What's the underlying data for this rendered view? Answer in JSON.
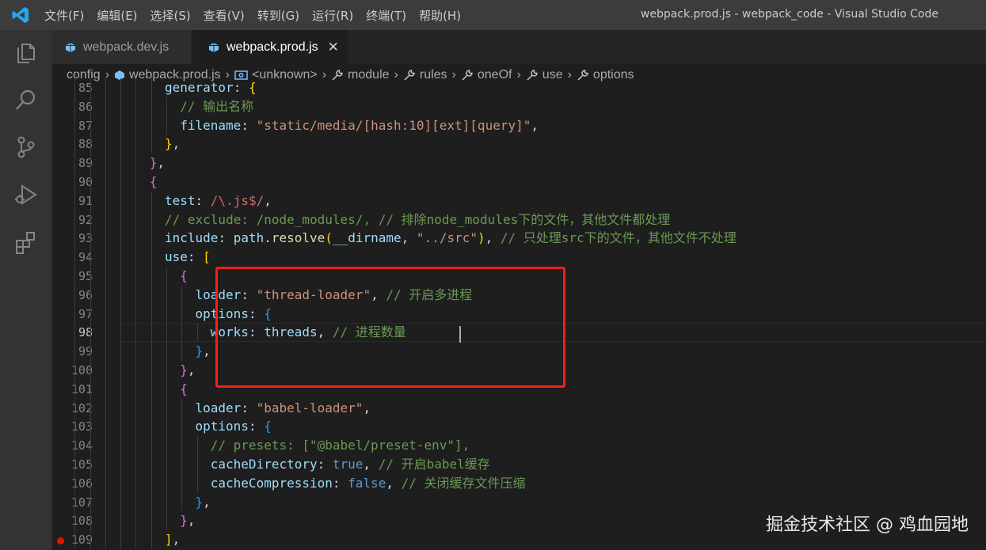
{
  "window": {
    "title": "webpack.prod.js - webpack_code - Visual Studio Code"
  },
  "menu": [
    {
      "label": "文件(F)",
      "name": "menu-file"
    },
    {
      "label": "编辑(E)",
      "name": "menu-edit"
    },
    {
      "label": "选择(S)",
      "name": "menu-selection"
    },
    {
      "label": "查看(V)",
      "name": "menu-view"
    },
    {
      "label": "转到(G)",
      "name": "menu-go"
    },
    {
      "label": "运行(R)",
      "name": "menu-run"
    },
    {
      "label": "终端(T)",
      "name": "menu-terminal"
    },
    {
      "label": "帮助(H)",
      "name": "menu-help"
    }
  ],
  "activity_bar": [
    "explorer-icon",
    "search-icon",
    "source-control-icon",
    "run-debug-icon",
    "extensions-icon"
  ],
  "tabs": [
    {
      "label": "webpack.dev.js",
      "active": false
    },
    {
      "label": "webpack.prod.js",
      "active": true,
      "close": "✕"
    }
  ],
  "breadcrumb": [
    {
      "label": "config"
    },
    {
      "label": "webpack.prod.js"
    },
    {
      "label": "<unknown>"
    },
    {
      "label": "module"
    },
    {
      "label": "rules"
    },
    {
      "label": "oneOf"
    },
    {
      "label": "use"
    },
    {
      "label": "options"
    }
  ],
  "editor": {
    "active_line": 98,
    "lines": [
      {
        "n": 85,
        "indent": 6,
        "tokens": [
          [
            "k",
            "generator"
          ],
          [
            "p",
            ": "
          ],
          [
            "y",
            "{"
          ]
        ]
      },
      {
        "n": 86,
        "indent": 7,
        "tokens": [
          [
            "c",
            "// 输出名称"
          ]
        ]
      },
      {
        "n": 87,
        "indent": 7,
        "tokens": [
          [
            "k",
            "filename"
          ],
          [
            "p",
            ": "
          ],
          [
            "s",
            "\"static/media/[hash:10][ext][query]\""
          ],
          [
            "p",
            ","
          ]
        ]
      },
      {
        "n": 88,
        "indent": 6,
        "tokens": [
          [
            "y",
            "}"
          ],
          [
            "p",
            ","
          ]
        ]
      },
      {
        "n": 89,
        "indent": 5,
        "tokens": [
          [
            "m",
            "}"
          ],
          [
            "p",
            ","
          ]
        ]
      },
      {
        "n": 90,
        "indent": 5,
        "tokens": [
          [
            "m",
            "{"
          ]
        ]
      },
      {
        "n": 91,
        "indent": 6,
        "tokens": [
          [
            "k",
            "test"
          ],
          [
            "p",
            ": "
          ],
          [
            "r",
            "/\\.js$/"
          ],
          [
            "p",
            ","
          ]
        ]
      },
      {
        "n": 92,
        "indent": 6,
        "tokens": [
          [
            "c",
            "// exclude: /node_modules/, // 排除node_modules下的文件，其他文件都处理"
          ]
        ]
      },
      {
        "n": 93,
        "indent": 6,
        "tokens": [
          [
            "k",
            "include"
          ],
          [
            "p",
            ": "
          ],
          [
            "k",
            "path"
          ],
          [
            "p",
            "."
          ],
          [
            "f",
            "resolve"
          ],
          [
            "y",
            "("
          ],
          [
            "k",
            "__dirname"
          ],
          [
            "p",
            ", "
          ],
          [
            "s",
            "\"../src\""
          ],
          [
            "y",
            ")"
          ],
          [
            "p",
            ", "
          ],
          [
            "c",
            "// 只处理src下的文件，其他文件不处理"
          ]
        ]
      },
      {
        "n": 94,
        "indent": 6,
        "tokens": [
          [
            "k",
            "use"
          ],
          [
            "p",
            ": "
          ],
          [
            "y",
            "["
          ]
        ]
      },
      {
        "n": 95,
        "indent": 7,
        "tokens": [
          [
            "m",
            "{"
          ]
        ]
      },
      {
        "n": 96,
        "indent": 8,
        "tokens": [
          [
            "k",
            "loader"
          ],
          [
            "p",
            ": "
          ],
          [
            "s",
            "\"thread-loader\""
          ],
          [
            "p",
            ", "
          ],
          [
            "c",
            "// 开启多进程"
          ]
        ]
      },
      {
        "n": 97,
        "indent": 8,
        "tokens": [
          [
            "k",
            "options"
          ],
          [
            "p",
            ": "
          ],
          [
            "bl",
            "{"
          ]
        ]
      },
      {
        "n": 98,
        "indent": 9,
        "tokens": [
          [
            "k",
            "works"
          ],
          [
            "p",
            ": "
          ],
          [
            "k",
            "threads"
          ],
          [
            "p",
            ", "
          ],
          [
            "c",
            "// 进程数量"
          ]
        ]
      },
      {
        "n": 99,
        "indent": 8,
        "tokens": [
          [
            "bl",
            "}"
          ],
          [
            "p",
            ","
          ]
        ]
      },
      {
        "n": 100,
        "indent": 7,
        "tokens": [
          [
            "m",
            "}"
          ],
          [
            "p",
            ","
          ]
        ]
      },
      {
        "n": 101,
        "indent": 7,
        "tokens": [
          [
            "m",
            "{"
          ]
        ]
      },
      {
        "n": 102,
        "indent": 8,
        "tokens": [
          [
            "k",
            "loader"
          ],
          [
            "p",
            ": "
          ],
          [
            "s",
            "\"babel-loader\""
          ],
          [
            "p",
            ","
          ]
        ]
      },
      {
        "n": 103,
        "indent": 8,
        "tokens": [
          [
            "k",
            "options"
          ],
          [
            "p",
            ": "
          ],
          [
            "bl",
            "{"
          ]
        ]
      },
      {
        "n": 104,
        "indent": 9,
        "tokens": [
          [
            "c",
            "// presets: [\"@babel/preset-env\"],"
          ]
        ]
      },
      {
        "n": 105,
        "indent": 9,
        "tokens": [
          [
            "k",
            "cacheDirectory"
          ],
          [
            "p",
            ": "
          ],
          [
            "b",
            "true"
          ],
          [
            "p",
            ", "
          ],
          [
            "c",
            "// 开启babel缓存"
          ]
        ]
      },
      {
        "n": 106,
        "indent": 9,
        "tokens": [
          [
            "k",
            "cacheCompression"
          ],
          [
            "p",
            ": "
          ],
          [
            "b",
            "false"
          ],
          [
            "p",
            ", "
          ],
          [
            "c",
            "// 关闭缓存文件压缩"
          ]
        ]
      },
      {
        "n": 107,
        "indent": 8,
        "tokens": [
          [
            "bl",
            "}"
          ],
          [
            "p",
            ","
          ]
        ]
      },
      {
        "n": 108,
        "indent": 7,
        "tokens": [
          [
            "m",
            "}"
          ],
          [
            "p",
            ","
          ]
        ]
      },
      {
        "n": 109,
        "indent": 6,
        "tokens": [
          [
            "y",
            "]"
          ],
          [
            "p",
            ","
          ]
        ],
        "breakpoint": true
      }
    ]
  },
  "watermark": "掘金技术社区 @ 鸡血园地"
}
